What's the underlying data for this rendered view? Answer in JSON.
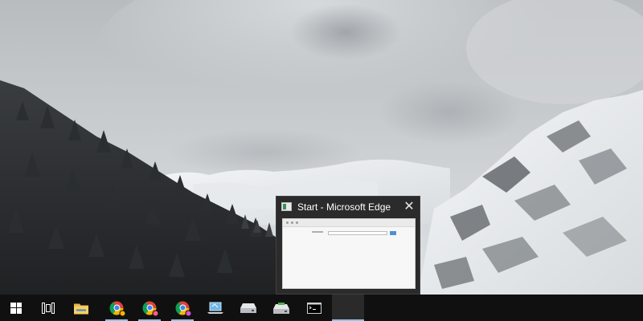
{
  "wallpaper": {
    "description_icon": "snowy-mountain-forest-wallpaper"
  },
  "preview": {
    "title": "Start - Microsoft Edge",
    "app_icon": "edge-window-icon",
    "close_glyph": "✕"
  },
  "taskbar": {
    "items": [
      {
        "name": "start-button",
        "icon": "windows-logo-icon"
      },
      {
        "name": "task-view-button",
        "icon": "task-view-icon"
      },
      {
        "name": "file-explorer-button",
        "icon": "folder-icon"
      },
      {
        "name": "chrome-button-1",
        "icon": "chrome-icon",
        "badge_color": "#f4b400"
      },
      {
        "name": "chrome-button-2",
        "icon": "chrome-icon",
        "badge_color": "#ff5c8a"
      },
      {
        "name": "chrome-button-3",
        "icon": "chrome-icon",
        "badge_color": "#d94fd4"
      },
      {
        "name": "remote-desktop-button",
        "icon": "laptop-icon"
      },
      {
        "name": "drive-button-1",
        "icon": "disk-drive-icon"
      },
      {
        "name": "drive-button-2",
        "icon": "usb-drive-icon"
      },
      {
        "name": "command-prompt-button",
        "icon": "terminal-icon"
      },
      {
        "name": "edge-active-button",
        "icon": "blank-app-icon"
      }
    ],
    "accent": "#8ec3ee",
    "background": "#101010"
  }
}
